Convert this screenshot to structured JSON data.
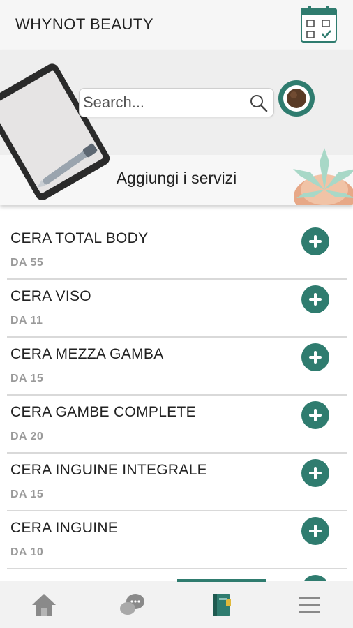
{
  "header": {
    "title": "WHYNOT BEAUTY",
    "calendar_icon": "calendar-check-icon"
  },
  "hero": {
    "search_placeholder": "Search...",
    "search_icon": "search-icon",
    "avatar_icon": "coffee-cup-icon",
    "subtitle": "Aggiungi i servizi"
  },
  "services": [
    {
      "name": "CERA TOTAL BODY",
      "price": "DA 55"
    },
    {
      "name": "CERA VISO",
      "price": "DA 11"
    },
    {
      "name": "CERA MEZZA GAMBA",
      "price": "DA 15"
    },
    {
      "name": "CERA GAMBE COMPLETE",
      "price": "DA 20"
    },
    {
      "name": "CERA INGUINE INTEGRALE",
      "price": "DA 15"
    },
    {
      "name": "CERA INGUINE",
      "price": "DA 10"
    }
  ],
  "tabbar": {
    "tabs": [
      "home-icon",
      "chat-bubbles-icon",
      "notebook-icon",
      "menu-icon"
    ],
    "active_tab": 2
  },
  "colors": {
    "accent": "#2f7c6f",
    "header_bg": "#f6f6f6",
    "muted_text": "#9a9a9a"
  }
}
